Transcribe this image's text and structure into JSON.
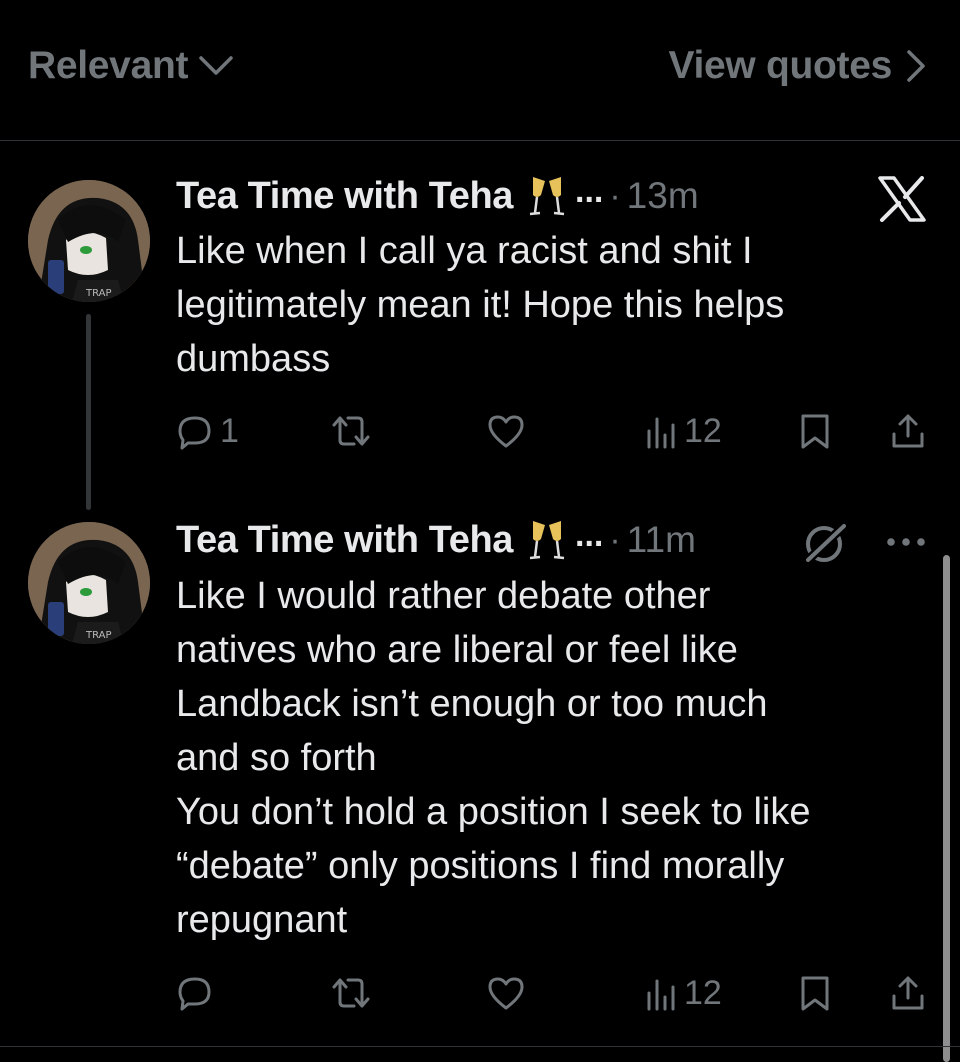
{
  "topbar": {
    "sort_label": "Relevant",
    "quotes_label": "View quotes"
  },
  "posts": [
    {
      "author": "Tea Time with Teha",
      "emoji": "🥂",
      "ellipsis": "...",
      "dot": "·",
      "time": "13m",
      "text": "Like when I call ya racist and shit I\nlegitimately mean it! Hope this helps\ndumbass",
      "replies": "1",
      "reposts": "",
      "likes": "",
      "views": "12"
    },
    {
      "author": "Tea Time with Teha",
      "emoji": "🥂",
      "ellipsis": "...",
      "dot": "·",
      "time": "11m",
      "text": "Like I would rather debate other\nnatives who are liberal or feel like\nLandback isn’t enough or too much\nand so forth\nYou don’t hold a position I seek to like\n“debate” only positions I find morally\nrepugnant",
      "replies": "",
      "reposts": "",
      "likes": "",
      "views": "12"
    }
  ],
  "icons": {
    "sort": "chevron-down-icon",
    "quotes": "chevron-right-icon",
    "brand": "x-logo-icon",
    "grok": "grok-icon",
    "more": "more-icon",
    "reply": "reply-icon",
    "repost": "repost-icon",
    "like": "like-icon",
    "views": "views-icon",
    "bookmark": "bookmark-icon",
    "share": "share-icon"
  },
  "colors": {
    "background": "#000000",
    "text": "#e7e9ea",
    "muted": "#71767b",
    "divider": "#2f3336"
  }
}
